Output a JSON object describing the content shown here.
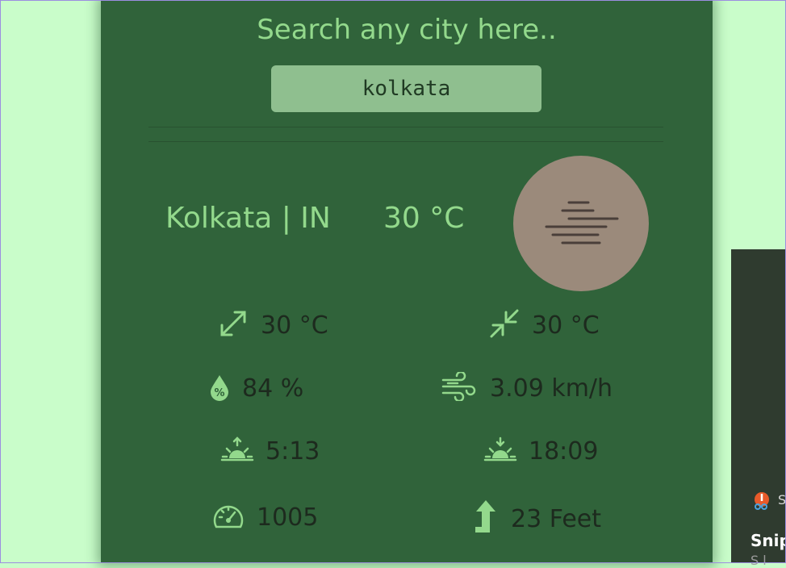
{
  "search": {
    "heading": "Search any city here..",
    "value": "kolkata"
  },
  "location": {
    "city_country": "Kolkata | IN",
    "temperature": "30 °C",
    "weather_icon": "mist-icon"
  },
  "stats": {
    "max_temp": {
      "icon": "expand-arrows-icon",
      "value": "30 °C"
    },
    "min_temp": {
      "icon": "compress-arrows-icon",
      "value": "30 °C"
    },
    "humidity": {
      "icon": "humidity-drop-icon",
      "value": "84 %"
    },
    "wind": {
      "icon": "wind-icon",
      "value": "3.09 km/h"
    },
    "sunrise": {
      "icon": "sunrise-icon",
      "value": "5:13"
    },
    "sunset": {
      "icon": "sunset-icon",
      "value": "18:09"
    },
    "pressure": {
      "icon": "gauge-icon",
      "value": "1005"
    },
    "elevation": {
      "icon": "arrow-up-icon",
      "value": "23 Feet"
    }
  },
  "notification": {
    "app_letter": "S",
    "title": "Snip",
    "sub": "S l"
  },
  "colors": {
    "page_bg": "#c9fdca",
    "card_bg": "#30633a",
    "accent_text": "#93d98c",
    "input_bg": "#8fbf8f",
    "icon_circle": "#9b8a7b"
  }
}
